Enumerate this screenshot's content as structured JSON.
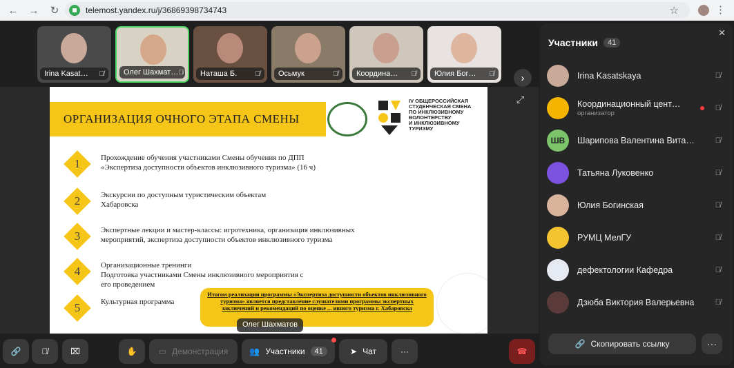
{
  "browser": {
    "url": "telemost.yandex.ru/j/36869398734743"
  },
  "tiles": [
    {
      "name": "Irina Kasat…",
      "face": "#c8a99a",
      "bg": "#4a4a4a"
    },
    {
      "name": "Олег Шахмат…",
      "face": "#d6a88a",
      "bg": "#d9d3c6"
    },
    {
      "name": "Наташа Б.",
      "face": "#b98a7a",
      "bg": "#6a5040"
    },
    {
      "name": "Осьмук",
      "face": "#caa28e",
      "bg": "#8a7a68"
    },
    {
      "name": "Координа…",
      "face": "#c99f90",
      "bg": "#cfc6bc"
    },
    {
      "name": "Юлия Бог…",
      "face": "#deb6a0",
      "bg": "#e8e3e0"
    }
  ],
  "slide": {
    "title": "ОРГАНИЗАЦИЯ ОЧНОГО ЭТАПА СМЕНЫ",
    "logo_text": "IV ОБЩЕРОССИЙСКАЯ\nСТУДЕНЧЕСКАЯ СМЕНА\nПО ИНКЛЮЗИВНОМУ\nВОЛОНТЕРСТВУ\nИ ИНКЛЮЗИВНОМУ\nТУРИЗМУ",
    "items": [
      {
        "num": "1",
        "text": "Прохождение обучения участниками Смены обучения по ДПП\n«Экспертиза доступности объектов инклюзивного туризма» (16 ч)"
      },
      {
        "num": "2",
        "text": "Экскурсии по доступным туристическим объектам\nХабаровска"
      },
      {
        "num": "3",
        "text": "Экспертные лекции и мастер-классы: игротехника, организация инклюзивных\nмероприятий, экспертиза доступности объектов инклюзивного туризма"
      },
      {
        "num": "4",
        "text": "Организационные тренинги\nПодготовка участниками Смены инклюзивного мероприятия с\nего проведением"
      },
      {
        "num": "5",
        "text": "Культурная программа"
      }
    ],
    "summary": "Итогом реализации программы «Экспертиза доступности объектов инклюзивного туризма» является представление слушателями программы экспертных заключений и рекомендаций по оценке ... ивного туризма г. Хабаровска"
  },
  "speaker_tag": "Олег Шахматов",
  "toolbar": {
    "demo_label": "Демонстрация",
    "participants_label": "Участники",
    "participants_count": "41",
    "chat_label": "Чат"
  },
  "sidebar": {
    "title": "Участники",
    "count": "41",
    "copy_link": "Скопировать ссылку",
    "participants": [
      {
        "name": "Irina Kasatskaya",
        "sub": "",
        "initials": "",
        "color": "#c8a99a",
        "live": false
      },
      {
        "name": "Координационный цент…",
        "sub": "организатор",
        "initials": "",
        "color": "#f4b400",
        "live": true
      },
      {
        "name": "Шарипова Валентина Вита…",
        "sub": "",
        "initials": "ШВ",
        "color": "#7bc46a",
        "live": false
      },
      {
        "name": "Татьяна Луковенко",
        "sub": "",
        "initials": "",
        "color": "#7b52e0",
        "live": false
      },
      {
        "name": "Юлия Богинская",
        "sub": "",
        "initials": "",
        "color": "#d9b39c",
        "live": false
      },
      {
        "name": "РУМЦ МелГУ",
        "sub": "",
        "initials": "",
        "color": "#f4c430",
        "live": false
      },
      {
        "name": "дефектологии Кафедра",
        "sub": "",
        "initials": "",
        "color": "#e6eaf2",
        "live": false
      },
      {
        "name": "Дзюба Виктория Валерьевна",
        "sub": "",
        "initials": "",
        "color": "#5a3a3a",
        "live": false
      }
    ]
  }
}
